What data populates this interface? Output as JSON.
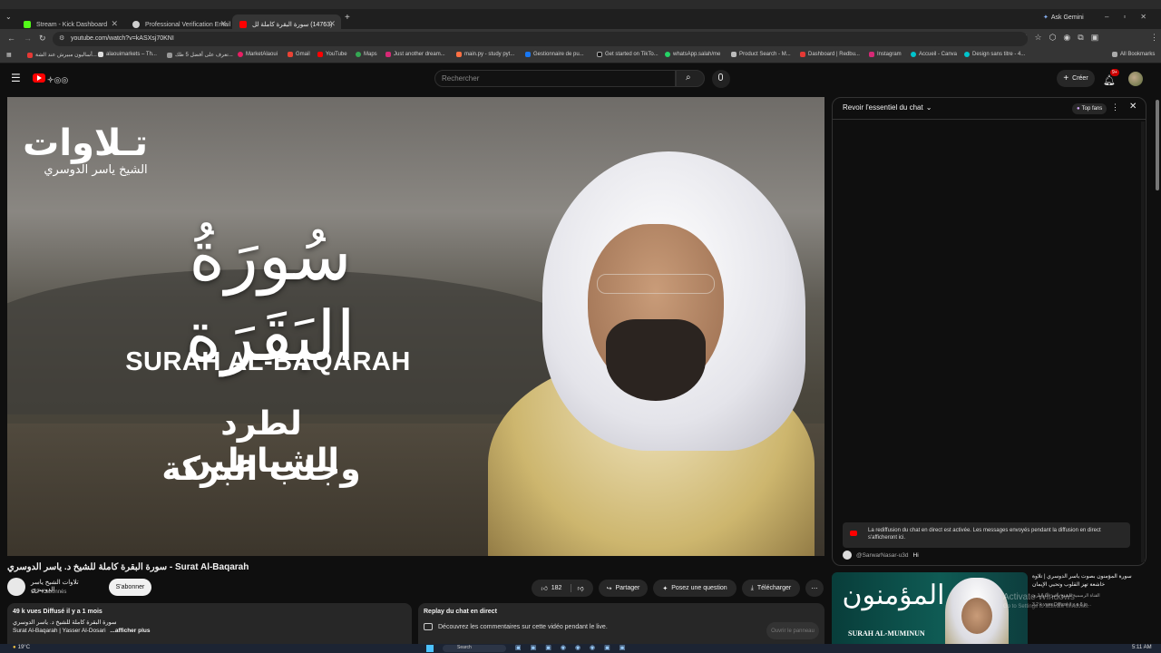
{
  "browser": {
    "tabs": [
      {
        "label": "Stream - Kick Dashboard",
        "active": false
      },
      {
        "label": "Professional Verification Email",
        "active": false
      },
      {
        "label": "(14763) سورة البقرة كاملة لل",
        "active": true
      }
    ],
    "new_tab": "+",
    "ask_gemini": "Ask Gemini",
    "url": "youtube.com/watch?v=kASXsj70KNI",
    "bookmarks": [
      "أساليون مبيرش عند الشة...",
      "alaouimarkets – Th...",
      "تعرف على أفضل 5 طك...",
      "MarketAlaoui",
      "Gmail",
      "YouTube",
      "Maps",
      "Just another dream...",
      "main.py - study pyt...",
      "Gestionnaire de pu...",
      "Get started on TikTo...",
      "whatsApp.salah/me",
      "Product Search - M...",
      "Dashboard | Redbu...",
      "Instagram",
      "Accueil - Canva",
      "Design sans titre - 4..."
    ],
    "all_bookmarks": "All Bookmarks"
  },
  "youtube": {
    "search_placeholder": "Rechercher",
    "create_label": "Créer",
    "notif_count": "9+"
  },
  "video": {
    "top_title": "تـلاوات",
    "top_subtitle": "الشيخ ياسر الدوسري",
    "calligraphy": "سُورَةُ البَقَرَة",
    "english_title": "SURAH AL-BAQARAH",
    "bottom_line1": "لطرد الشياطين",
    "bottom_line2": "وجلب البركة",
    "page_title": "سورة البقرة كاملة للشيخ د. ياسر الدوسري - Surat Al-Baqarah"
  },
  "channel": {
    "name": "تلاوات الشيخ ياسر الدوسري",
    "subs": "127 k abonnés",
    "subscribe_label": "S'abonner"
  },
  "actions": {
    "likes": "182",
    "share": "Partager",
    "ask": "Posez une question",
    "download": "Télécharger",
    "more": "⋯"
  },
  "description": {
    "stats": "49 k vues  Diffusé il y a 1 mois",
    "line1": "سورة البقرة كاملة للشيخ د. ياسر الدوسري",
    "line2": "Surat Al-Baqarah | Yasser Al-Dosari",
    "more": "...afficher plus"
  },
  "chat": {
    "header": "Revoir l'essentiel du chat",
    "top_fans": "Top fans",
    "notice": "La rediffusion du chat en direct est activée. Les messages envoyés pendant la diffusion en direct s'afficheront ici.",
    "msg_user": "@SarwarNasar-u3d",
    "msg_text": "Hi"
  },
  "replay": {
    "title": "Replay du chat en direct",
    "text": "Découvrez les commentaires sur cette vidéo pendant le live.",
    "button": "Ouvrir le panneau"
  },
  "recommend": {
    "title": "سورة المؤمنون بصوت ياسر الدوسري | تلاوة خاشعة تهز القلوب وتحيي الإيمان",
    "channel": "القناة الرسمية للشيخ ياسر الدوسري",
    "meta": "3,2 k vues  Diffusé il y a 8 jo...",
    "thumb_arabic": "المؤمنون",
    "thumb_english": "SURAH AL-MUMINUN",
    "watermark1": "Activate Windows",
    "watermark2": "Go to Settings to activate Windows."
  },
  "taskbar": {
    "weather": "19°C",
    "search": "Search",
    "time": "5:11 AM"
  },
  "colors": {
    "yt_red": "#ff0000",
    "bg": "#0f0f0f",
    "pill": "#272727"
  }
}
